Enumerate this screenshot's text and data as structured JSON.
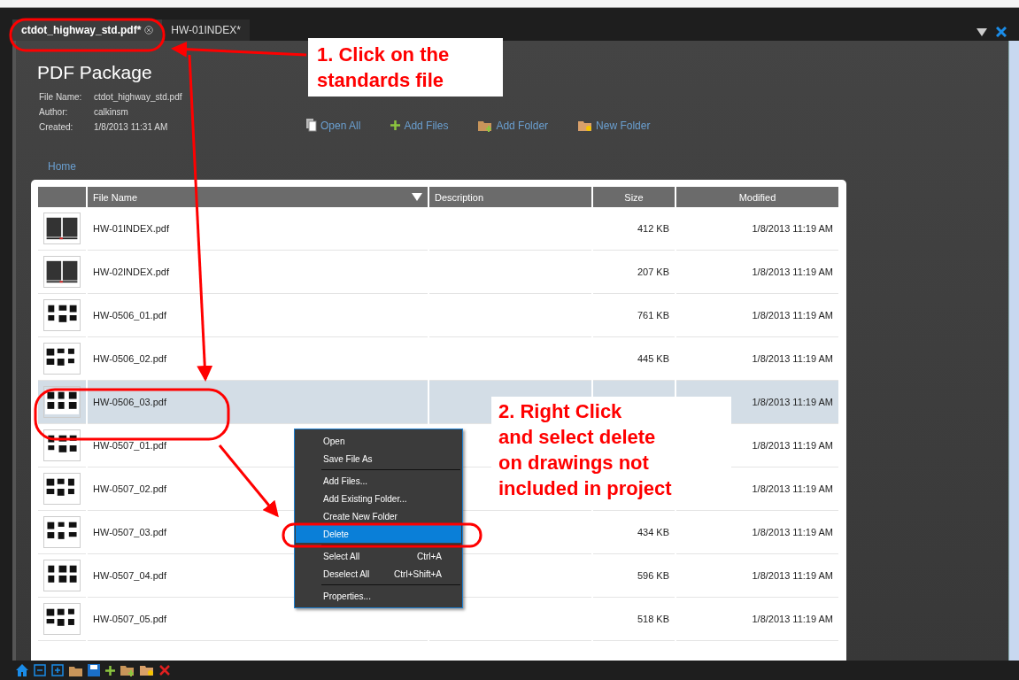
{
  "tabs": [
    {
      "label": "ctdot_highway_std.pdf*",
      "selected": true,
      "closable": true
    },
    {
      "label": "HW-01INDEX*",
      "selected": false,
      "closable": false
    }
  ],
  "package": {
    "title": "PDF Package",
    "meta": [
      {
        "label": "File Name:",
        "value": "ctdot_highway_std.pdf"
      },
      {
        "label": "Author:",
        "value": "calkinsm"
      },
      {
        "label": "Created:",
        "value": "1/8/2013 11:31 AM"
      }
    ],
    "actions": [
      {
        "kind": "open",
        "label": "Open All"
      },
      {
        "kind": "add",
        "label": "Add Files"
      },
      {
        "kind": "addfolder",
        "label": "Add Folder"
      },
      {
        "kind": "newfolder",
        "label": "New Folder"
      }
    ],
    "breadcrumb": "Home"
  },
  "table": {
    "columns": [
      "File Name",
      "Description",
      "Size",
      "Modified"
    ],
    "rows": [
      {
        "name": "HW-01INDEX.pdf",
        "size": "412 KB",
        "modified": "1/8/2013 11:19 AM",
        "selected": false
      },
      {
        "name": "HW-02INDEX.pdf",
        "size": "207 KB",
        "modified": "1/8/2013 11:19 AM",
        "selected": false
      },
      {
        "name": "HW-0506_01.pdf",
        "size": "761 KB",
        "modified": "1/8/2013 11:19 AM",
        "selected": false
      },
      {
        "name": "HW-0506_02.pdf",
        "size": "445 KB",
        "modified": "1/8/2013 11:19 AM",
        "selected": false
      },
      {
        "name": "HW-0506_03.pdf",
        "modified": "1/8/2013 11:19 AM",
        "selected": true
      },
      {
        "name": "HW-0507_01.pdf",
        "modified": "1/8/2013 11:19 AM",
        "selected": false
      },
      {
        "name": "HW-0507_02.pdf",
        "modified": "1/8/2013 11:19 AM",
        "selected": false
      },
      {
        "name": "HW-0507_03.pdf",
        "size": "434 KB",
        "modified": "1/8/2013 11:19 AM",
        "selected": false
      },
      {
        "name": "HW-0507_04.pdf",
        "size": "596 KB",
        "modified": "1/8/2013 11:19 AM",
        "selected": false
      },
      {
        "name": "HW-0507_05.pdf",
        "size": "518 KB",
        "modified": "1/8/2013 11:19 AM",
        "selected": false
      }
    ]
  },
  "context_menu": [
    {
      "kind": "item",
      "label": "Open",
      "selected": false
    },
    {
      "kind": "item",
      "label": "Save File As",
      "selected": false
    },
    {
      "kind": "separator"
    },
    {
      "kind": "item",
      "label": "Add Files...",
      "selected": false
    },
    {
      "kind": "item",
      "label": "Add Existing Folder...",
      "selected": false
    },
    {
      "kind": "item",
      "label": "Create New Folder",
      "selected": false
    },
    {
      "kind": "item",
      "label": "Delete",
      "selected": true
    },
    {
      "kind": "separator"
    },
    {
      "kind": "item",
      "label": "Select All",
      "shortcut": "Ctrl+A",
      "selected": false
    },
    {
      "kind": "item",
      "label": "Deselect All",
      "shortcut": "Ctrl+Shift+A",
      "selected": false
    },
    {
      "kind": "separator"
    },
    {
      "kind": "item",
      "label": "Properties...",
      "selected": false
    }
  ],
  "annotations": [
    {
      "lines": [
        "1. Click on the",
        "standards file"
      ]
    },
    {
      "lines": [
        "2. Right Click",
        "and select delete",
        "on drawings not",
        "included in project"
      ]
    }
  ]
}
